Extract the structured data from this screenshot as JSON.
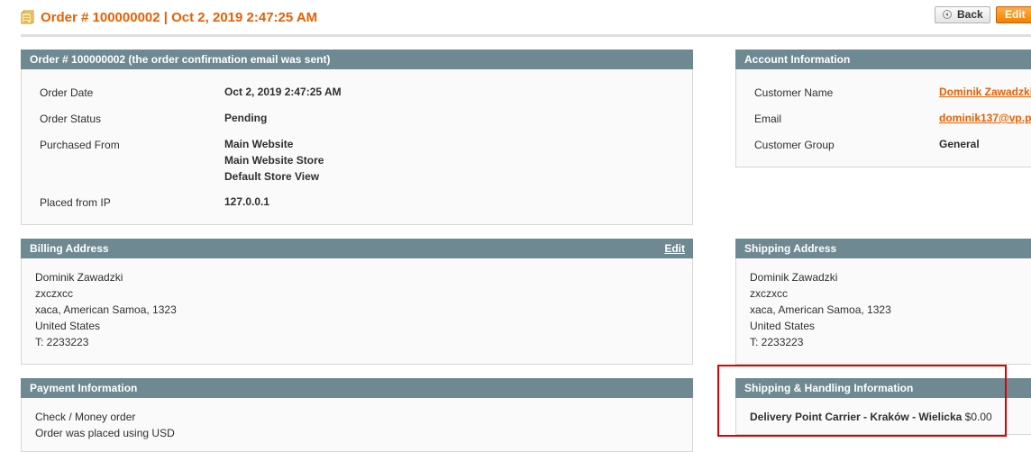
{
  "header": {
    "title": "Order # 100000002 | Oct 2, 2019 2:47:25 AM",
    "back_label": "Back",
    "edit_label": "Edit"
  },
  "order": {
    "heading": "Order # 100000002 (the order confirmation email was sent)",
    "order_date_label": "Order Date",
    "order_date": "Oct 2, 2019 2:47:25 AM",
    "status_label": "Order Status",
    "status": "Pending",
    "purchased_from_label": "Purchased From",
    "purchased_from": [
      "Main Website",
      "Main Website Store",
      "Default Store View"
    ],
    "ip_label": "Placed from IP",
    "ip": "127.0.0.1"
  },
  "account": {
    "heading": "Account Information",
    "name_label": "Customer Name",
    "name": "Dominik Zawadzki",
    "email_label": "Email",
    "email": "dominik137@vp.p",
    "group_label": "Customer Group",
    "group": "General"
  },
  "billing": {
    "heading": "Billing Address",
    "edit_label": "Edit",
    "lines": [
      "Dominik Zawadzki",
      "zxczxcc",
      "xaca, American Samoa, 1323",
      "United States",
      "T: 2233223"
    ]
  },
  "shipping": {
    "heading": "Shipping Address",
    "lines": [
      "Dominik Zawadzki",
      "zxczxcc",
      "xaca, American Samoa, 1323",
      "United States",
      "T: 2233223"
    ]
  },
  "payment": {
    "heading": "Payment Information",
    "lines": [
      "Check / Money order",
      "Order was placed using USD"
    ]
  },
  "shipping_handling": {
    "heading": "Shipping & Handling Information",
    "method": "Delivery Point Carrier - Kraków - Wielicka",
    "price": "$0.00"
  },
  "colors": {
    "accent": "#eb5e00",
    "box_header": "#6f8992",
    "highlight": "#dd0000"
  }
}
